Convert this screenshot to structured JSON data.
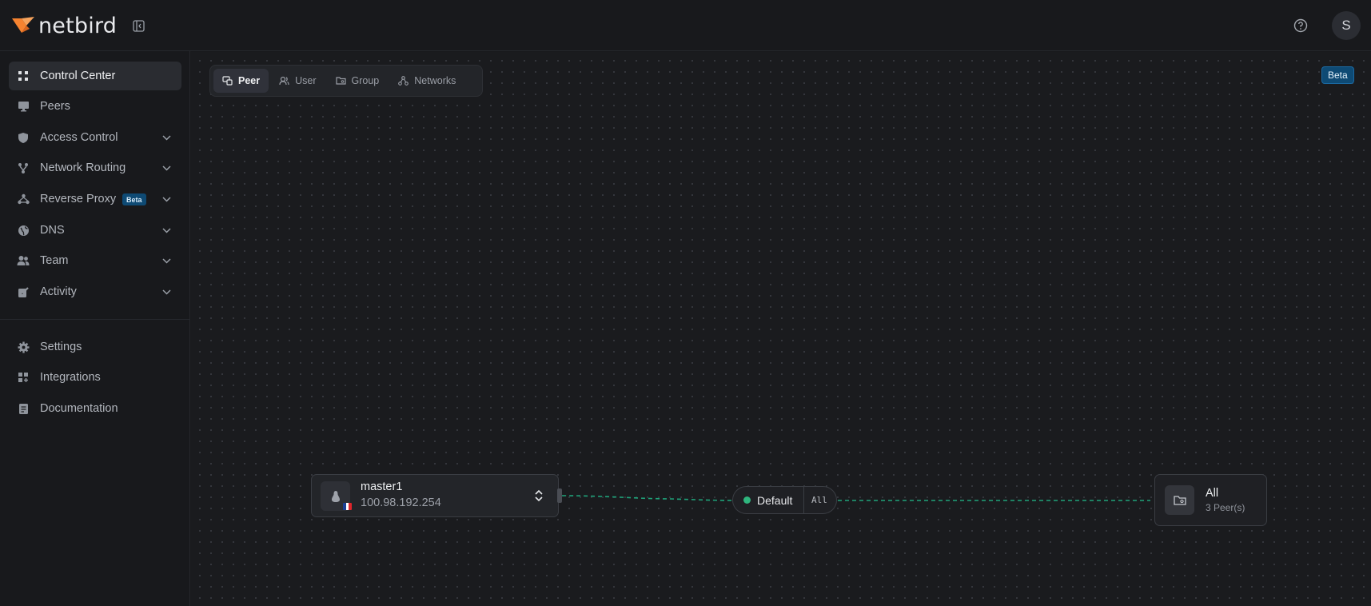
{
  "app": {
    "brand": "netbird",
    "brand_color": "#f68330",
    "user_initial": "S"
  },
  "header": {
    "collapse_icon": "sidebar-collapse-icon",
    "help_icon": "help-circle-icon"
  },
  "sidebar": {
    "primary": [
      {
        "label": "Control Center",
        "icon": "control-center-icon",
        "active": true,
        "expandable": false
      },
      {
        "label": "Peers",
        "icon": "monitor-icon",
        "active": false,
        "expandable": false
      },
      {
        "label": "Access Control",
        "icon": "shield-icon",
        "active": false,
        "expandable": true
      },
      {
        "label": "Network Routing",
        "icon": "git-branch-icon",
        "active": false,
        "expandable": true
      },
      {
        "label": "Reverse Proxy",
        "icon": "nodes-icon",
        "active": false,
        "expandable": true,
        "badge": "Beta"
      },
      {
        "label": "DNS",
        "icon": "globe-icon",
        "active": false,
        "expandable": true
      },
      {
        "label": "Team",
        "icon": "users-icon",
        "active": false,
        "expandable": true
      },
      {
        "label": "Activity",
        "icon": "activity-icon",
        "active": false,
        "expandable": true
      }
    ],
    "secondary": [
      {
        "label": "Settings",
        "icon": "gear-icon"
      },
      {
        "label": "Integrations",
        "icon": "integrations-icon"
      },
      {
        "label": "Documentation",
        "icon": "book-icon"
      }
    ]
  },
  "canvas": {
    "tabs": [
      {
        "label": "Peer",
        "icon": "peer-icon",
        "active": true
      },
      {
        "label": "User",
        "icon": "user-icon",
        "active": false
      },
      {
        "label": "Group",
        "icon": "folder-icon",
        "active": false
      },
      {
        "label": "Networks",
        "icon": "network-icon",
        "active": false
      }
    ],
    "beta_label": "Beta",
    "peer": {
      "name": "master1",
      "ip": "100.98.192.254",
      "os_icon": "linux-tux-icon",
      "country_flag": "fr-flag-icon"
    },
    "policy": {
      "name": "Default",
      "protocol": "All",
      "status_color": "#2fb67e"
    },
    "group": {
      "name": "All",
      "count": "3 Peer(s)",
      "icon": "folder-group-icon"
    },
    "edge_color": "#1fa37a"
  }
}
